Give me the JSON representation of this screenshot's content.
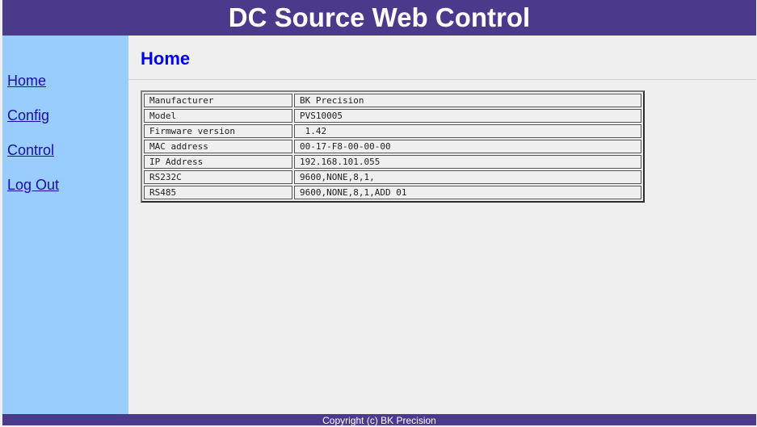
{
  "header": {
    "title": "DC Source Web Control"
  },
  "nav": {
    "items": [
      {
        "label": "Home"
      },
      {
        "label": "Config"
      },
      {
        "label": "Control"
      },
      {
        "label": "Log Out"
      }
    ]
  },
  "main": {
    "title": "Home",
    "info_rows": [
      {
        "key": "Manufacturer",
        "value": "BK Precision"
      },
      {
        "key": "Model",
        "value": "PVS10005"
      },
      {
        "key": "Firmware version",
        "value": " 1.42"
      },
      {
        "key": "MAC address",
        "value": "00-17-F8-00-00-00"
      },
      {
        "key": "IP Address",
        "value": "192.168.101.055"
      },
      {
        "key": "RS232C",
        "value": "9600,NONE,8,1,"
      },
      {
        "key": "RS485",
        "value": "9600,NONE,8,1,ADD 01"
      }
    ]
  },
  "footer": {
    "text": "Copyright (c) BK Precision"
  },
  "colors": {
    "header_bg": "#4b3a8c",
    "sidebar_bg": "#99ccff",
    "page_bg": "#efefef",
    "title_color": "#0000ee",
    "link_color": "#1a0dab"
  }
}
